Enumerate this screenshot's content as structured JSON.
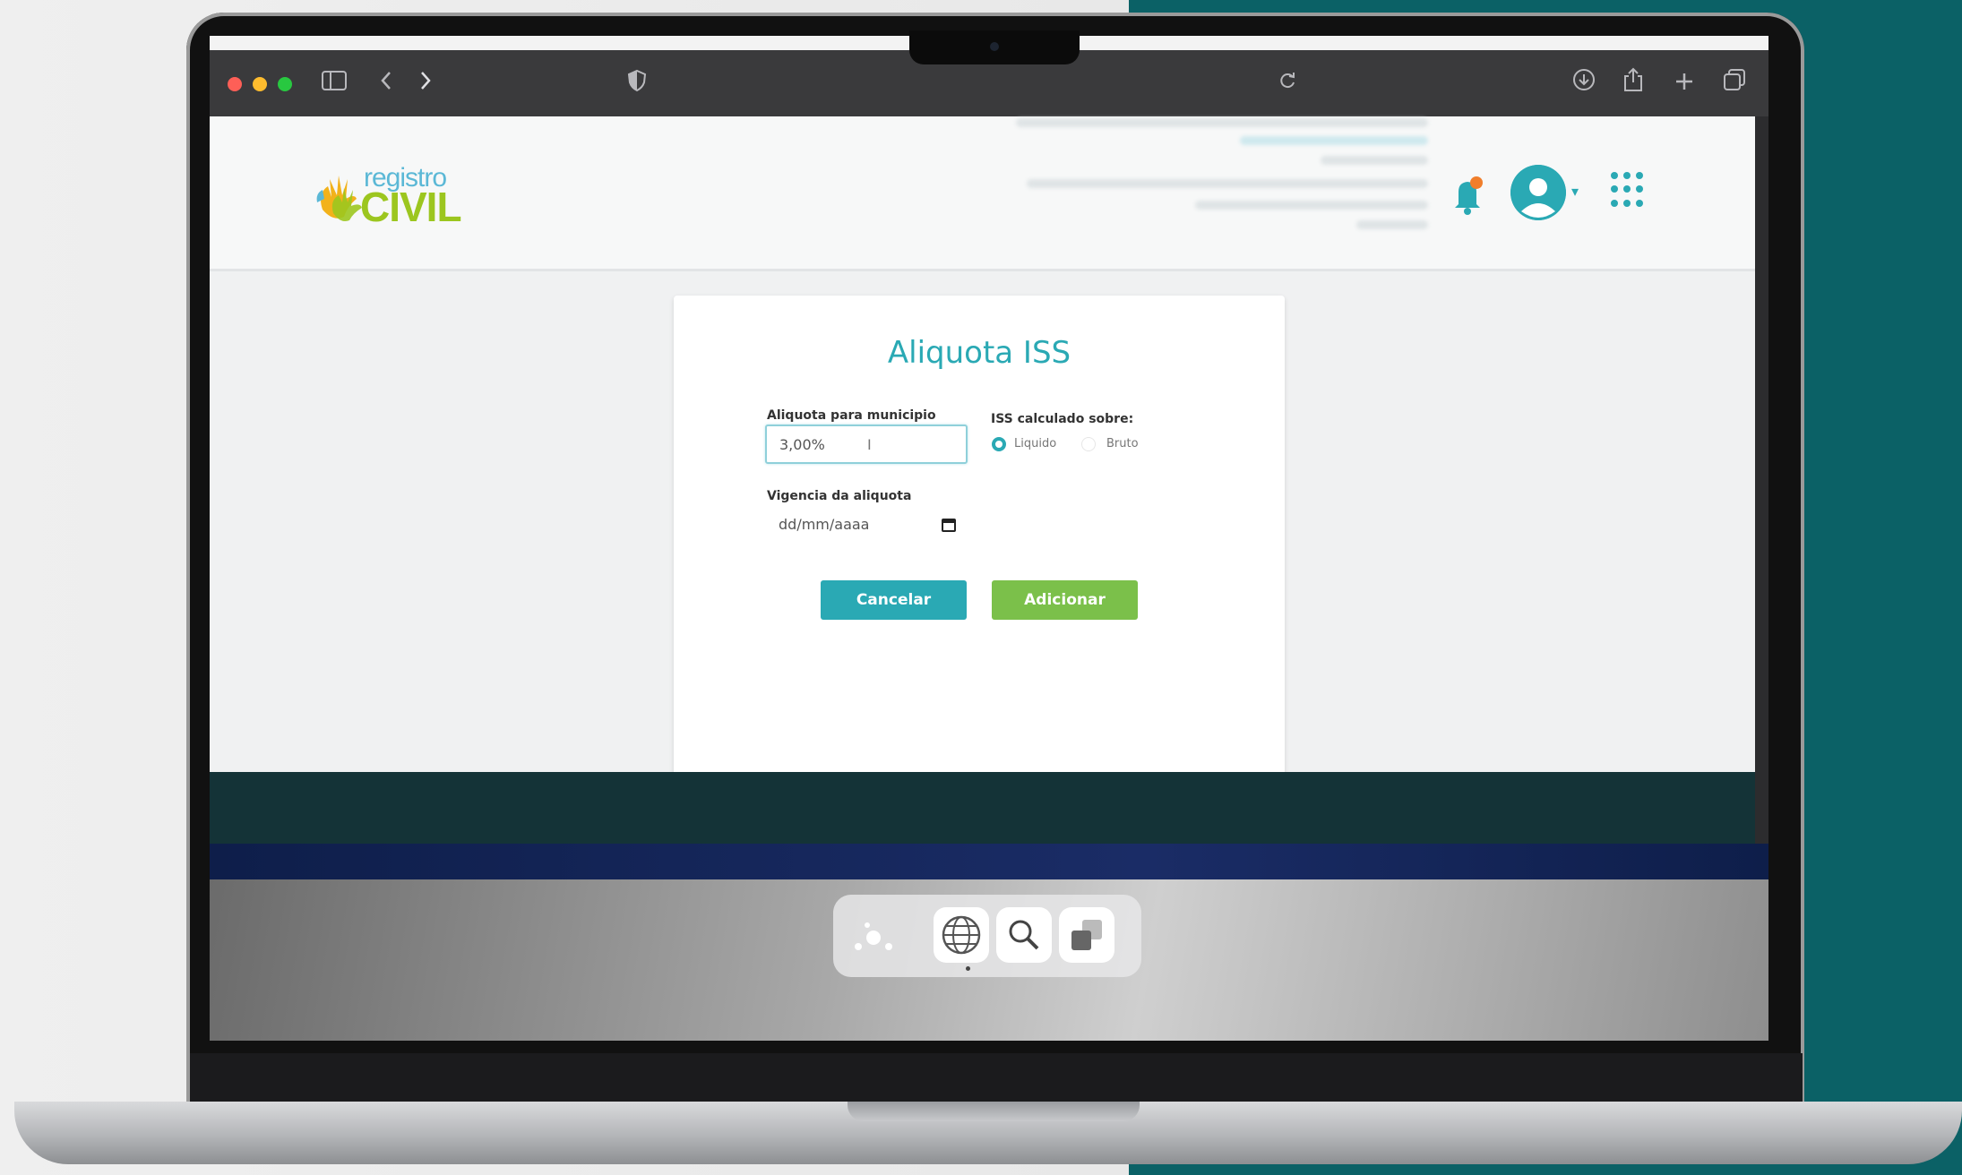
{
  "browser": {
    "toolbar_icons": [
      "sidebar-icon",
      "back-icon",
      "forward-icon",
      "shield-icon",
      "reload-icon",
      "download-icon",
      "share-icon",
      "new-tab-icon",
      "tabs-overview-icon"
    ]
  },
  "site": {
    "logo_top": "registro",
    "logo_bottom": "CIVIL",
    "accent_color": "#2aa9b4",
    "notification_count": ""
  },
  "modal": {
    "title": "Aliquota ISS",
    "rate_label": "Aliquota para municipio",
    "rate_value": "3,00%",
    "iss_label": "ISS calculado sobre:",
    "radio_options": [
      {
        "label": "Liquido",
        "selected": true
      },
      {
        "label": "Bruto",
        "selected": false
      }
    ],
    "validity_label": "Vigencia da aliquota",
    "validity_placeholder": "dd/mm/aaaa",
    "cancel_label": "Cancelar",
    "add_label": "Adicionar",
    "cancel_color": "#2aa9b4",
    "add_color": "#7bc04a"
  },
  "dock": {
    "items": [
      "launchpad-icon",
      "globe-icon",
      "search-icon",
      "overlap-icon"
    ]
  }
}
